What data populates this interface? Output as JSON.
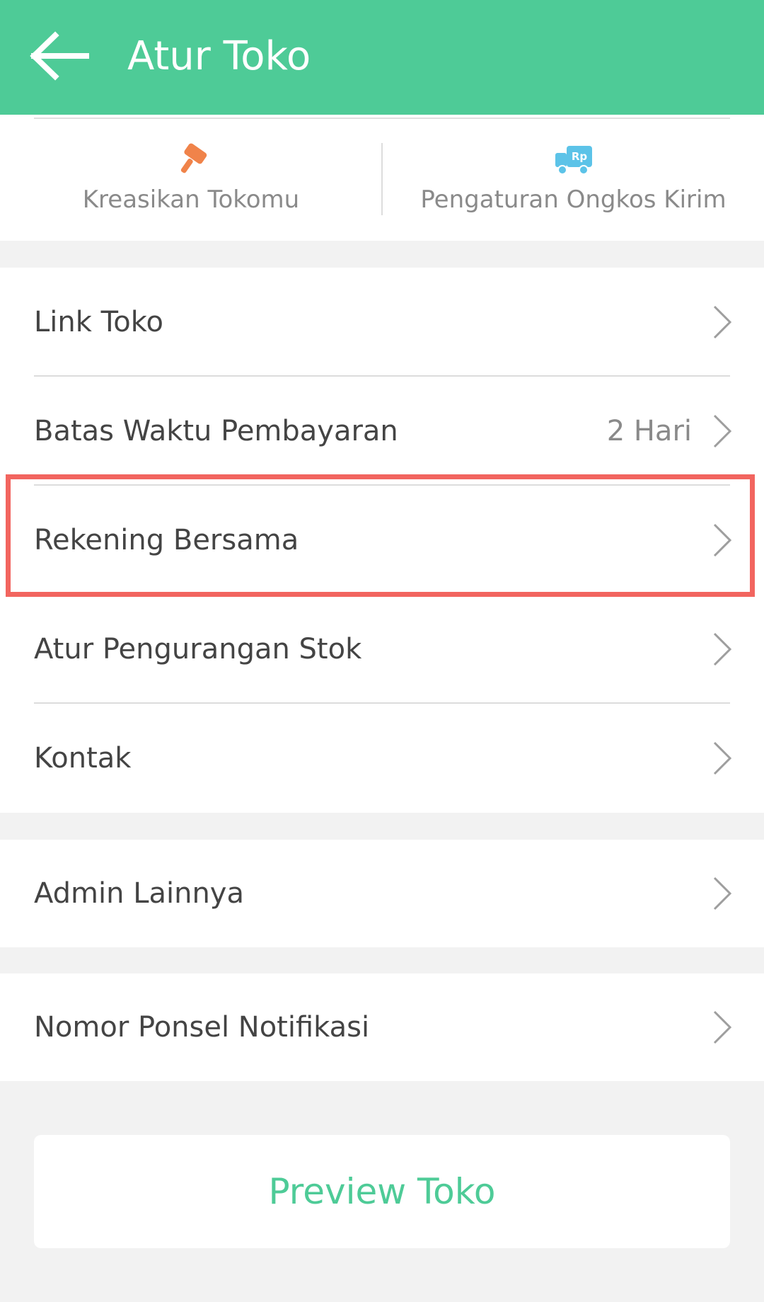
{
  "app_bar": {
    "title": "Atur Toko",
    "back_icon": "arrow-left-icon",
    "color": "#4ecb97"
  },
  "quick_actions": [
    {
      "label": "Kreasikan Tokomu",
      "icon": "paint-roller-icon",
      "icon_color": "#f0834a"
    },
    {
      "label": "Pengaturan Ongkos Kirim",
      "icon": "delivery-truck-rp-icon",
      "icon_color": "#5cc3e8"
    }
  ],
  "settings": {
    "group1": [
      {
        "label": "Link Toko",
        "value": ""
      },
      {
        "label": "Batas Waktu Pembayaran",
        "value": "2 Hari"
      },
      {
        "label": "Rekening Bersama",
        "value": "",
        "highlighted": true
      },
      {
        "label": "Atur Pengurangan Stok",
        "value": ""
      },
      {
        "label": "Kontak",
        "value": ""
      }
    ],
    "group2": [
      {
        "label": "Admin Lainnya",
        "value": ""
      }
    ],
    "group3": [
      {
        "label": "Nomor Ponsel Notifikasi",
        "value": ""
      }
    ]
  },
  "preview_button": {
    "label": "Preview Toko"
  },
  "colors": {
    "accent": "#4ecb97",
    "highlight": "#f2655f"
  }
}
